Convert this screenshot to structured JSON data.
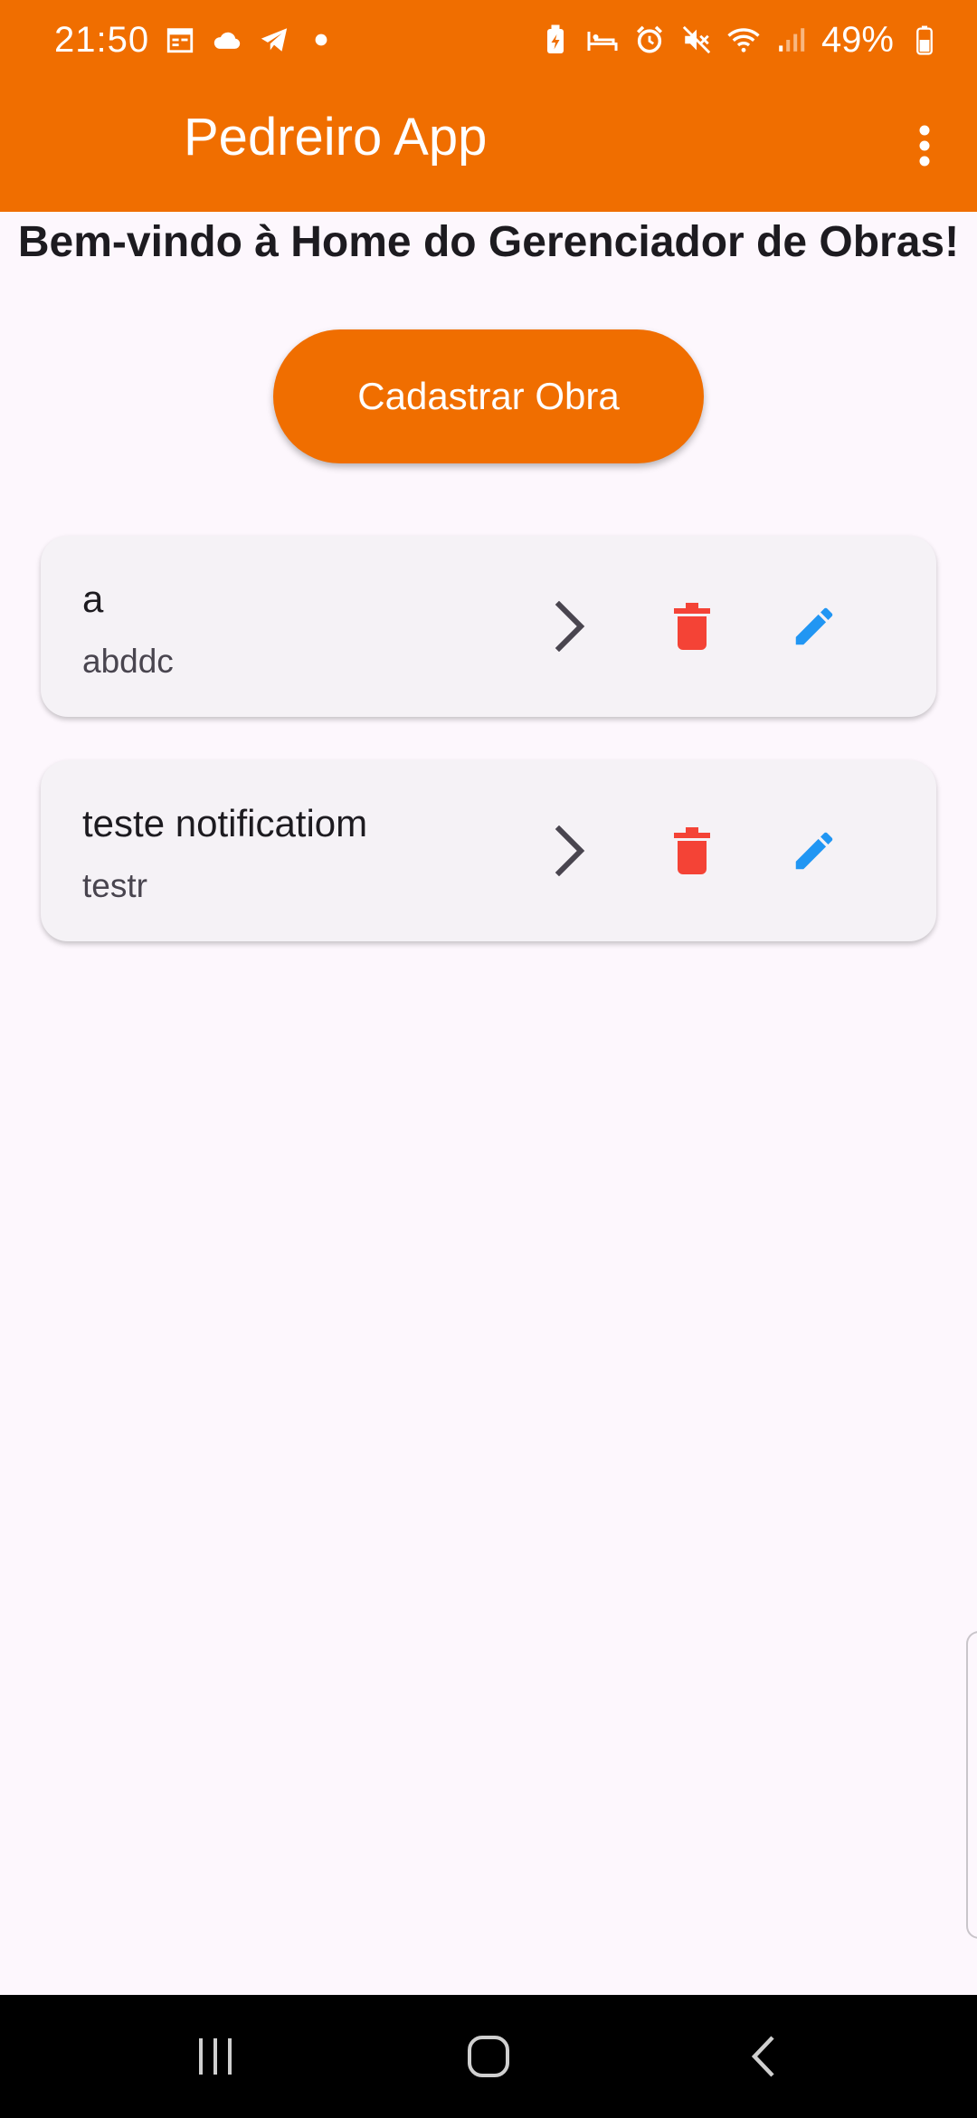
{
  "status_bar": {
    "time": "21:50",
    "battery": "49%",
    "icons_left": [
      "calendar-icon",
      "cloud-icon",
      "telegram-icon",
      "dot-icon"
    ],
    "icons_right": [
      "battery-saver-icon",
      "sleep-icon",
      "alarm-icon",
      "mute-icon",
      "wifi-icon",
      "signal-icon",
      "battery-icon"
    ]
  },
  "app_bar": {
    "title": "Pedreiro App",
    "menu_icon": "more-vert-icon"
  },
  "main": {
    "welcome": "Bem-vindo à Home do Gerenciador de Obras!",
    "cadastrar_label": "Cadastrar Obra",
    "obras": [
      {
        "title": "a",
        "subtitle": "abddc"
      },
      {
        "title": "teste notificatiom",
        "subtitle": "testr"
      }
    ]
  },
  "colors": {
    "primary": "#f06e00",
    "background": "#fdf7fd",
    "card": "#f5f2f6",
    "delete": "#f44336",
    "edit": "#2196f3",
    "chevron": "#49454f"
  },
  "nav_bar": {
    "icons": [
      "recents-icon",
      "home-icon",
      "back-icon"
    ]
  }
}
